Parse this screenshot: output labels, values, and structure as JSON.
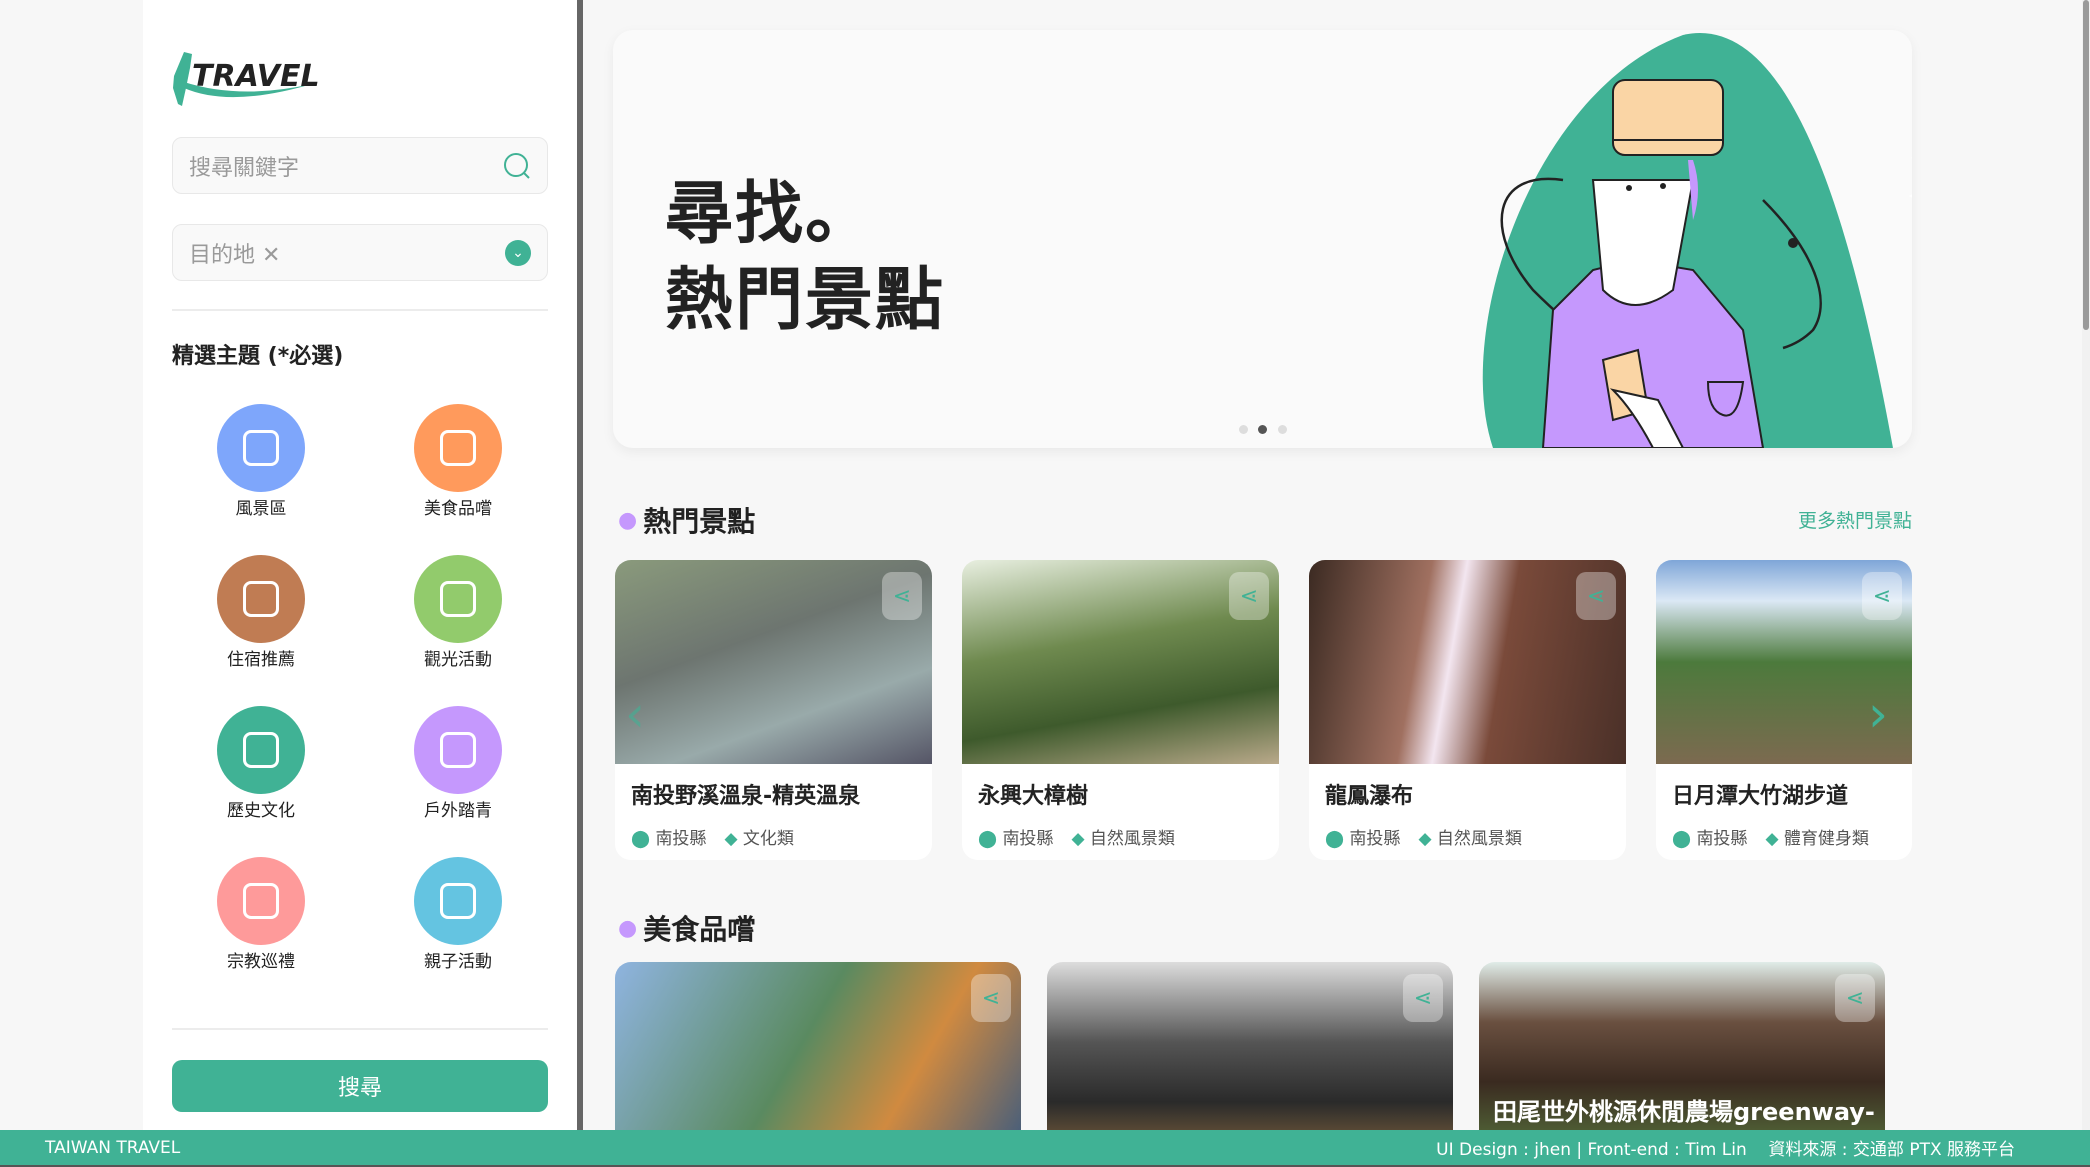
{
  "sidebar": {
    "logo_text": "TRAVEL",
    "search_placeholder": "搜尋關鍵字",
    "destination_label": "目的地",
    "themes_heading": "精選主題 (*必選)",
    "themes": [
      {
        "label": "風景區",
        "color": "#7ea6fb",
        "icon": "mountain-icon"
      },
      {
        "label": "美食品嚐",
        "color": "#ff9a5c",
        "icon": "bubble-tea-icon"
      },
      {
        "label": "住宿推薦",
        "color": "#c07c53",
        "icon": "hotel-icon"
      },
      {
        "label": "觀光活動",
        "color": "#92cb6c",
        "icon": "hot-air-balloon-icon"
      },
      {
        "label": "歷史文化",
        "color": "#40b295",
        "icon": "historic-building-icon"
      },
      {
        "label": "戶外踏青",
        "color": "#c598fd",
        "icon": "bicycle-icon"
      },
      {
        "label": "宗教巡禮",
        "color": "#fe9a9a",
        "icon": "temple-icon"
      },
      {
        "label": "親子活動",
        "color": "#64c4e1",
        "icon": "sky-lantern-icon"
      }
    ],
    "search_button": "搜尋"
  },
  "hero": {
    "line1": "尋找。",
    "line2": "熱門景點",
    "slides": 3,
    "active_slide": 2
  },
  "hot_spots": {
    "heading": "熱門景點",
    "more_link": "更多熱門景點",
    "cards": [
      {
        "title": "南投野溪溫泉-精英溫泉",
        "location": "南投縣",
        "category": "文化類"
      },
      {
        "title": "永興大樟樹",
        "location": "南投縣",
        "category": "自然風景類"
      },
      {
        "title": "龍鳳瀑布",
        "location": "南投縣",
        "category": "自然風景類"
      },
      {
        "title": "日月潭大竹湖步道",
        "location": "南投縣",
        "category": "體育健身類"
      }
    ]
  },
  "food": {
    "heading": "美食品嚐",
    "cards": [
      {
        "title": ""
      },
      {
        "title": ""
      },
      {
        "title": "田尾世外桃源休閒農場greenway-"
      }
    ]
  },
  "footer": {
    "brand": "TAIWAN TRAVEL",
    "credits": "UI Design : jhen | Front-end : Tim Lin",
    "source": "資料來源 : 交通部 PTX 服務平台"
  },
  "colors": {
    "primary": "#40b295",
    "accent_purple": "#c598fd"
  }
}
